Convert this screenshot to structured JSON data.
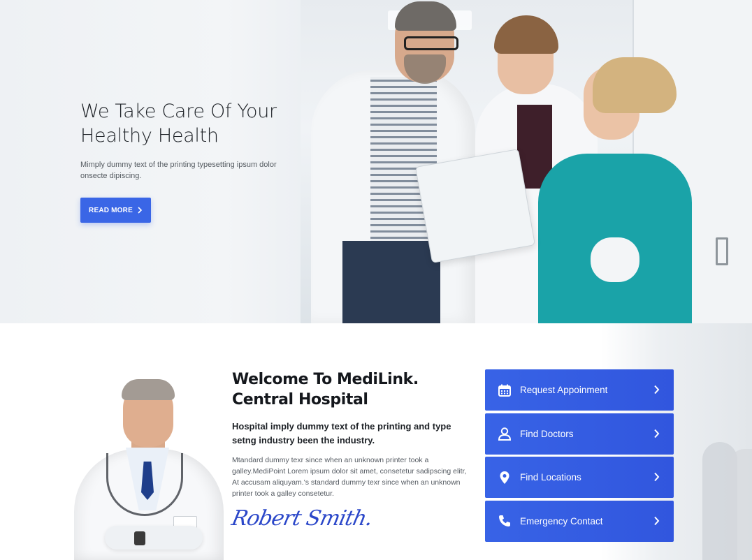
{
  "hero": {
    "title_line1": "We Take Care Of Your",
    "title_line2": "Healthy Health",
    "subtitle": "Mimply dummy text of the printing typesetting ipsum dolor onsecte dipiscing.",
    "button_label": "READ MORE"
  },
  "welcome": {
    "title_line1": "Welcome To MediLink.",
    "title_line2": "Central Hospital",
    "lead": "Hospital imply dummy text of the printing and type setng industry been the industry.",
    "body": "Mtandard dummy texr since when an unknown printer took a galley.MediPoint Lorem ipsum dolor sit amet, consetetur sadipscing elitr, At accusam aliquyam.'s standard dummy texr since when an unknown printer took a galley consetetur.",
    "signature": "Robert Smith."
  },
  "actions": [
    {
      "label": "Request Appoinment",
      "icon": "calendar-icon"
    },
    {
      "label": "Find Doctors",
      "icon": "user-icon"
    },
    {
      "label": "Find Locations",
      "icon": "map-pin-icon"
    },
    {
      "label": "Emergency Contact",
      "icon": "phone-icon"
    }
  ],
  "colors": {
    "accent": "#3a66e6",
    "heading": "#14171c",
    "body_text": "#555b62"
  }
}
